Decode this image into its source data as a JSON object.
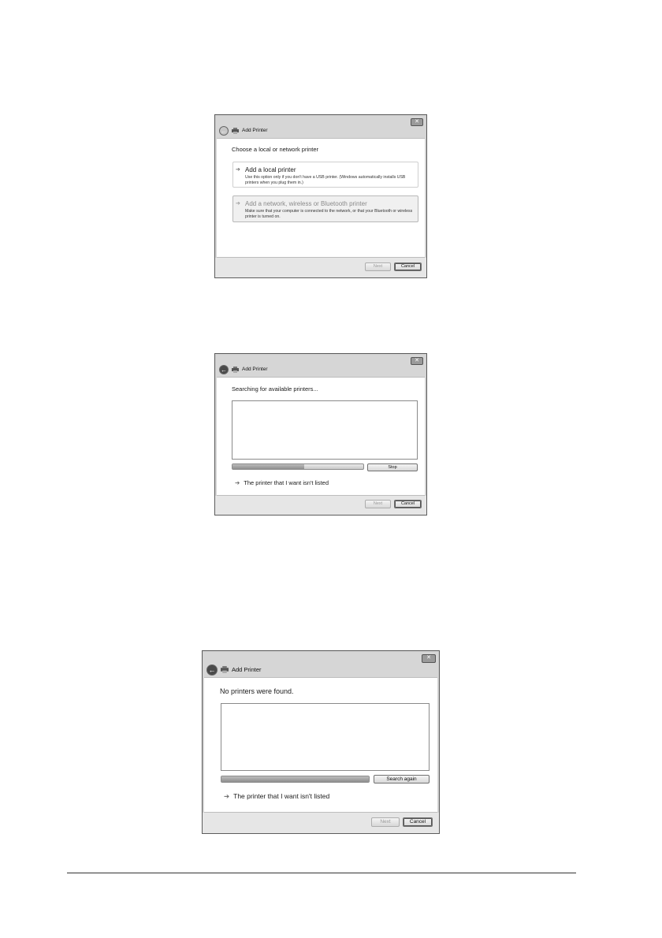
{
  "dialogs": [
    {
      "title": "Add Printer",
      "close_glyph": "✕",
      "heading": "Choose a local or network printer",
      "options": [
        {
          "title": "Add a local printer",
          "description": "Use this option only if you don't have a USB printer. (Windows automatically installs USB printers when you plug them in.)"
        },
        {
          "title": "Add a network, wireless or Bluetooth printer",
          "description": "Make sure that your computer is connected to the network, or that your Bluetooth or wireless printer is turned on."
        }
      ],
      "next_label": "Next",
      "cancel_label": "Cancel"
    },
    {
      "title": "Add Printer",
      "close_glyph": "✕",
      "heading": "Searching for available printers...",
      "progress": 0.55,
      "stop_label": "Stop",
      "link_label": "The printer that I want isn't listed",
      "next_label": "Next",
      "cancel_label": "Cancel"
    },
    {
      "title": "Add Printer",
      "close_glyph": "✕",
      "heading": "No printers were found.",
      "progress": 1.0,
      "search_again_label": "Search again",
      "link_label": "The printer that I want isn't listed",
      "next_label": "Next",
      "cancel_label": "Cancel"
    }
  ],
  "icons": {
    "arrow": "➔",
    "back": "back-arrow-icon",
    "printer": "printer-icon"
  }
}
